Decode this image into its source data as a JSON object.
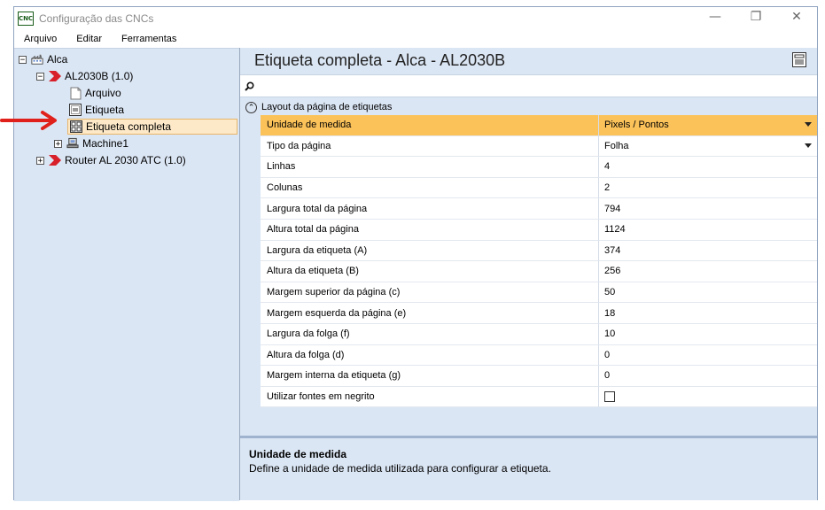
{
  "window": {
    "title": "Configuração das CNCs",
    "app_icon_text": "CNC",
    "controls": {
      "minimize": "—",
      "maximize": "❐",
      "close": "✕"
    }
  },
  "menu": [
    "Arquivo",
    "Editar",
    "Ferramentas"
  ],
  "tree": {
    "root": {
      "label": "Alca",
      "expander": "−"
    },
    "machine1": {
      "label": "AL2030B (1.0)",
      "expander": "−"
    },
    "children": [
      {
        "label": "Arquivo"
      },
      {
        "label": "Etiqueta"
      },
      {
        "label": "Etiqueta completa",
        "selected": true
      },
      {
        "label": "Machine1",
        "expander": "+"
      }
    ],
    "machine2": {
      "label": "Router AL 2030 ATC (1.0)",
      "expander": "+"
    }
  },
  "panel": {
    "title": "Etiqueta completa - Alca - AL2030B",
    "search_placeholder": ""
  },
  "group": {
    "label": "Layout da página de etiquetas",
    "collapse_glyph": "⌃"
  },
  "properties": [
    {
      "name": "Unidade de medida",
      "value": "Pixels / Pontos",
      "dropdown": true,
      "active": true
    },
    {
      "name": "Tipo da página",
      "value": "Folha",
      "dropdown": true
    },
    {
      "name": "Linhas",
      "value": "4"
    },
    {
      "name": "Colunas",
      "value": "2"
    },
    {
      "name": "Largura total da página",
      "value": "794"
    },
    {
      "name": "Altura total da página",
      "value": "1124"
    },
    {
      "name": "Largura da etiqueta (A)",
      "value": "374"
    },
    {
      "name": "Altura da etiqueta (B)",
      "value": "256"
    },
    {
      "name": "Margem superior da página (c)",
      "value": "50"
    },
    {
      "name": "Margem esquerda da página (e)",
      "value": "18"
    },
    {
      "name": "Largura da folga (f)",
      "value": "10"
    },
    {
      "name": "Altura da folga (d)",
      "value": "0"
    },
    {
      "name": "Margem interna da etiqueta (g)",
      "value": "0"
    },
    {
      "name": "Utilizar fontes em negrito",
      "value": "",
      "checkbox": true,
      "checked": false
    }
  ],
  "help": {
    "title": "Unidade de medida",
    "description": "Define a unidade de medida utilizada para configurar a etiqueta."
  },
  "colors": {
    "pane_bg": "#dbe6f4",
    "active_row": "#fbc25a",
    "selected_node": "#fde9c8",
    "annotation_arrow": "#e0201a",
    "machine_marker": "#d8202a"
  }
}
